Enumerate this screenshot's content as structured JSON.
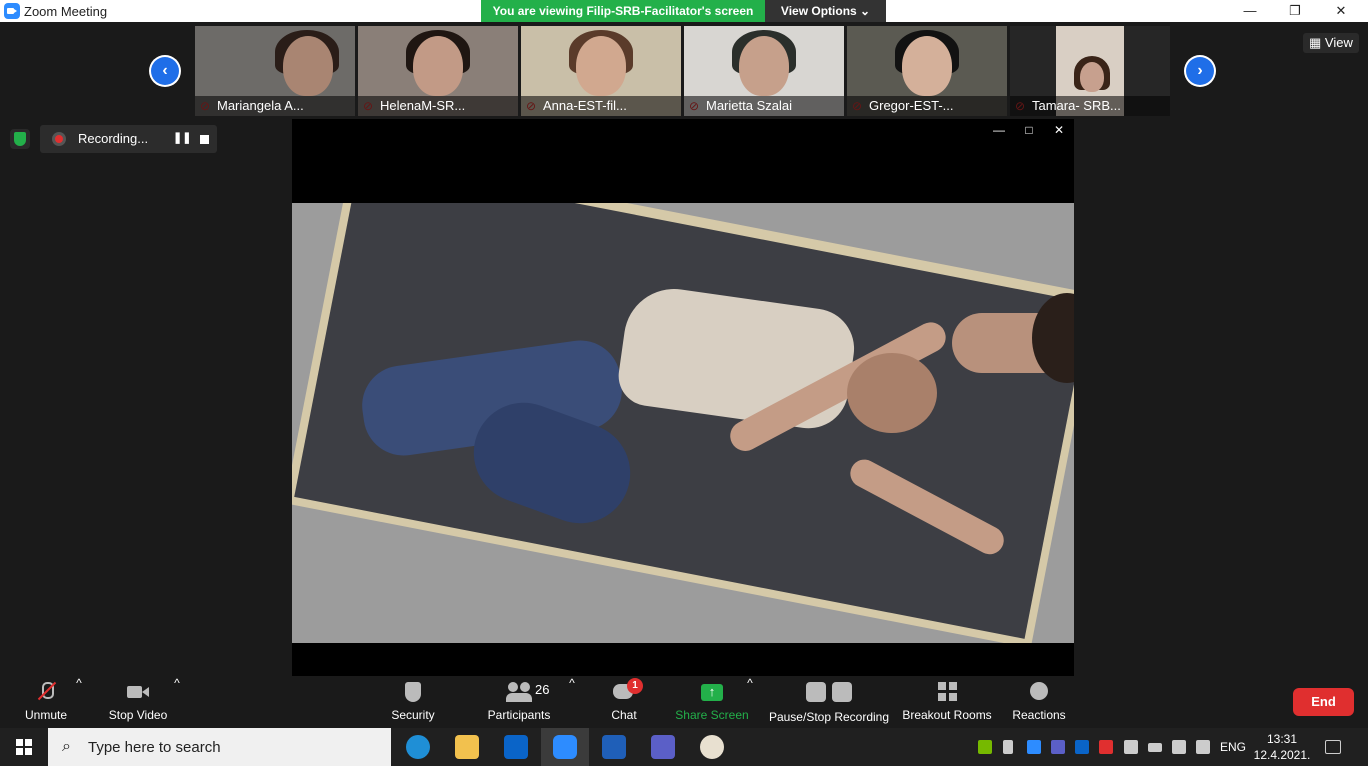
{
  "window": {
    "title": "Zoom Meeting",
    "viewing_banner": "You are viewing Filip-SRB-Facilitator's screen",
    "view_options": "View Options ⌄",
    "controls": {
      "minimize": "—",
      "restore": "❐",
      "close": "✕"
    }
  },
  "gallery": {
    "view_label": "View",
    "participants": [
      {
        "name": "Mariangela A..."
      },
      {
        "name": "HelenaM-SR..."
      },
      {
        "name": "Anna-EST-fil..."
      },
      {
        "name": "Marietta Szalai"
      },
      {
        "name": "Gregor-EST-..."
      },
      {
        "name": "Tamara- SRB..."
      }
    ],
    "prev_arrow": "‹",
    "next_arrow": "›"
  },
  "recording": {
    "label": "Recording...",
    "pause_glyph": "❚❚"
  },
  "share_window": {
    "minimize": "—",
    "maximize": "□",
    "close": "✕"
  },
  "toolbar": {
    "unmute": "Unmute",
    "stop_video": "Stop Video",
    "security": "Security",
    "participants": "Participants",
    "participants_count": "26",
    "chat": "Chat",
    "chat_badge": "1",
    "share_screen": "Share Screen",
    "pause_stop_recording": "Pause/Stop Recording",
    "breakout_rooms": "Breakout Rooms",
    "reactions": "Reactions",
    "end": "End",
    "caret": "^"
  },
  "taskbar": {
    "search_placeholder": "Type here to search",
    "language": "ENG",
    "time": "13:31",
    "date": "12.4.2021."
  },
  "colors": {
    "accent_green": "#23b04a",
    "end_red": "#e02f2f",
    "nav_blue": "#1f6ee8",
    "background": "#1a1a1a"
  }
}
